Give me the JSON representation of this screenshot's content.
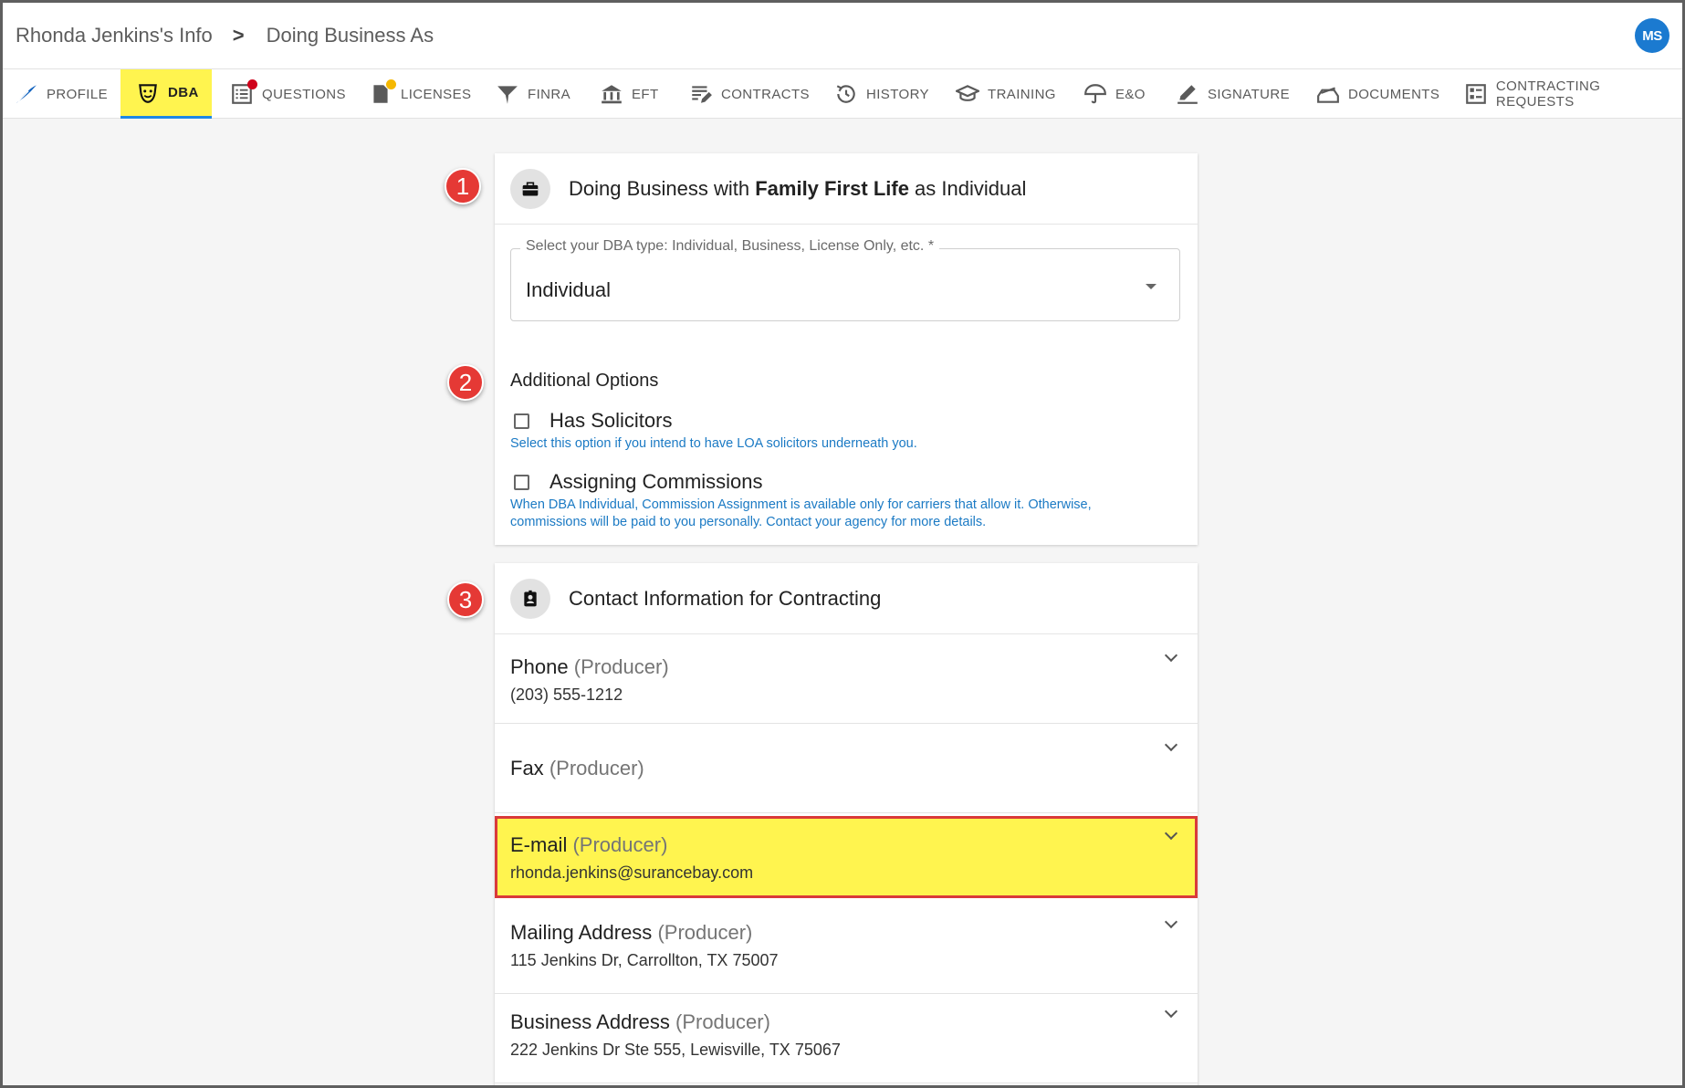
{
  "breadcrumb": {
    "parent": "Rhonda Jenkins's Info",
    "separator": ">",
    "current": "Doing Business As"
  },
  "user": {
    "initials": "MS"
  },
  "tabs": [
    {
      "label": "PROFILE",
      "icon": "feather-icon"
    },
    {
      "label": "DBA",
      "icon": "theater-mask-icon",
      "active": true
    },
    {
      "label": "QUESTIONS",
      "icon": "checklist-icon",
      "dot": "#d0021b"
    },
    {
      "label": "LICENSES",
      "icon": "document-icon",
      "dot": "#f5b800"
    },
    {
      "label": "FINRA",
      "icon": "funnel-icon"
    },
    {
      "label": "EFT",
      "icon": "bank-icon"
    },
    {
      "label": "CONTRACTS",
      "icon": "edit-list-icon"
    },
    {
      "label": "HISTORY",
      "icon": "history-icon"
    },
    {
      "label": "TRAINING",
      "icon": "graduation-cap-icon"
    },
    {
      "label": "E&O",
      "icon": "umbrella-icon"
    },
    {
      "label": "SIGNATURE",
      "icon": "pen-icon"
    },
    {
      "label": "DOCUMENTS",
      "icon": "tray-icon"
    },
    {
      "label": "CONTRACTING REQUESTS",
      "icon": "form-icon"
    }
  ],
  "dba_card": {
    "title_prefix": "Doing Business with ",
    "title_bold": "Family First Life",
    "title_suffix": " as Individual",
    "select_label": "Select your DBA type: Individual, Business, License Only, etc. *",
    "select_value": "Individual",
    "additional_title": "Additional Options",
    "options": [
      {
        "label": "Has Solicitors",
        "checked": false,
        "hint": "Select this option if you intend to have LOA solicitors underneath you."
      },
      {
        "label": "Assigning Commissions",
        "checked": false,
        "hint_line1": "When DBA Individual, Commission Assignment is available only for carriers that allow it. Otherwise,",
        "hint_line2": "commissions will be paid to you personally. Contact your agency for more details."
      }
    ]
  },
  "contact_card": {
    "title": "Contact Information for Contracting",
    "items": [
      {
        "label": "Phone",
        "sub": "(Producer)",
        "value": "(203) 555-1212"
      },
      {
        "label": "Fax",
        "sub": "(Producer)",
        "value": ""
      },
      {
        "label": "E-mail",
        "sub": "(Producer)",
        "value": "rhonda.jenkins@surancebay.com"
      },
      {
        "label": "Mailing Address",
        "sub": "(Producer)",
        "value": "115 Jenkins Dr, Carrollton, TX 75007"
      },
      {
        "label": "Business Address",
        "sub": "(Producer)",
        "value": "222 Jenkins Dr Ste 555, Lewisville, TX 75067"
      }
    ]
  },
  "callouts": [
    "1",
    "2",
    "3"
  ],
  "colors": {
    "accent_blue": "#1e88e5",
    "highlight_yellow": "#fff44f",
    "callout_red": "#e53935",
    "hint_blue": "#1b7ac4"
  }
}
